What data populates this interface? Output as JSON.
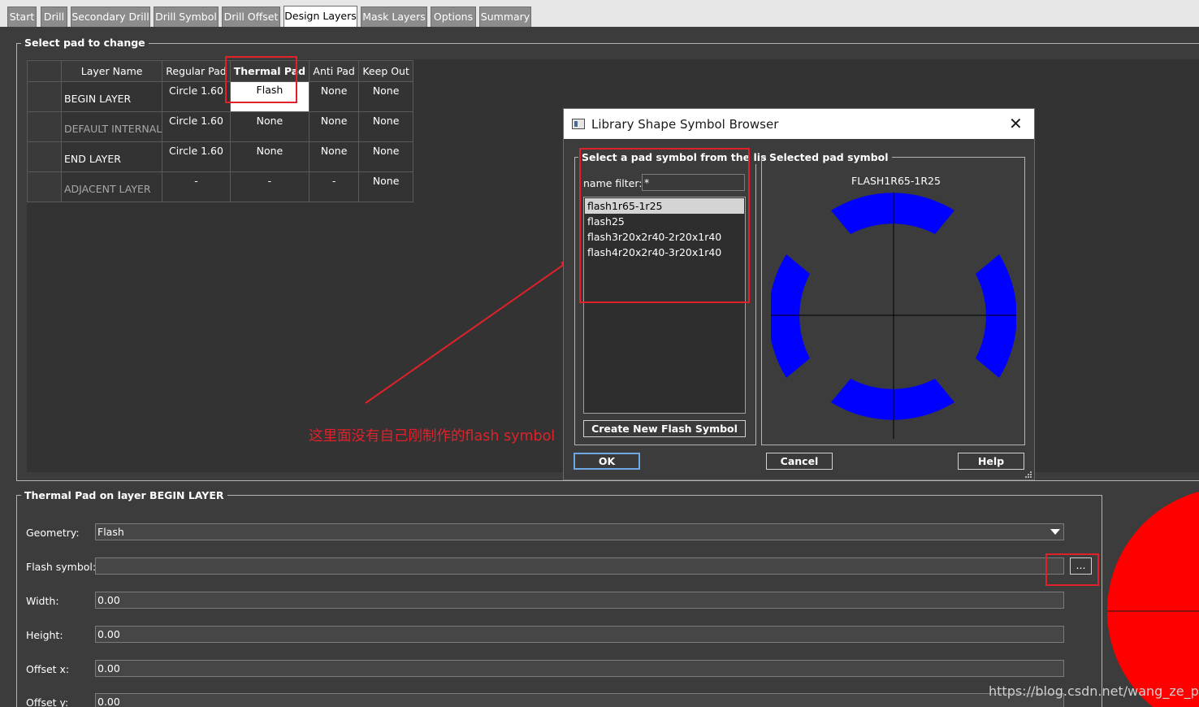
{
  "tabs": [
    "Start",
    "Drill",
    "Secondary Drill",
    "Drill Symbol",
    "Drill Offset",
    "Design Layers",
    "Mask Layers",
    "Options",
    "Summary"
  ],
  "active_tab": "Design Layers",
  "select_pad": {
    "title": "Select pad to change",
    "columns": [
      "Layer Name",
      "Regular Pad",
      "Thermal Pad",
      "Anti Pad",
      "Keep Out"
    ],
    "rows": [
      {
        "layer": "BEGIN LAYER",
        "regular": "Circle 1.60",
        "thermal": "Flash",
        "anti": "None",
        "keepout": "None"
      },
      {
        "layer": "DEFAULT INTERNAL",
        "regular": "Circle 1.60",
        "thermal": "None",
        "anti": "None",
        "keepout": "None"
      },
      {
        "layer": "END LAYER",
        "regular": "Circle 1.60",
        "thermal": "None",
        "anti": "None",
        "keepout": "None"
      },
      {
        "layer": "ADJACENT LAYER",
        "regular": "-",
        "thermal": "-",
        "anti": "-",
        "keepout": "None"
      }
    ]
  },
  "thermal_form": {
    "title": "Thermal Pad on layer BEGIN LAYER",
    "geometry_label": "Geometry:",
    "geometry_value": "Flash",
    "flash_symbol_label": "Flash symbol:",
    "flash_symbol_value": "",
    "browse_button": "...",
    "width_label": "Width:",
    "width_value": "0.00",
    "height_label": "Height:",
    "height_value": "0.00",
    "offset_x_label": "Offset x:",
    "offset_x_value": "0.00",
    "offset_y_label": "Offset y:",
    "offset_y_value": "0.00"
  },
  "dialog": {
    "title": "Library Shape Symbol Browser",
    "close": "✕",
    "list_group_title": "Select a pad symbol from the list",
    "name_filter_label": "name filter:",
    "name_filter_value": "*",
    "symbols": [
      "flash1r65-1r25",
      "flash25",
      "flash3r20x2r40-2r20x1r40",
      "flash4r20x2r40-3r20x1r40"
    ],
    "selected_symbol_index": 0,
    "create_button": "Create New Flash  Symbol",
    "preview_group_title": "Selected pad symbol",
    "preview_name": "FLASH1R65-1R25",
    "ok": "OK",
    "cancel": "Cancel",
    "help": "Help"
  },
  "annotation": "这里面没有自己刚制作的flash symbol",
  "watermark": "https://blog.csdn.net/wang_ze_ping",
  "colors": {
    "background": "#3c3c3c",
    "preview_shape": "#0000ff",
    "annotation": "#e0212a",
    "pad_preview": "#ff0000"
  }
}
